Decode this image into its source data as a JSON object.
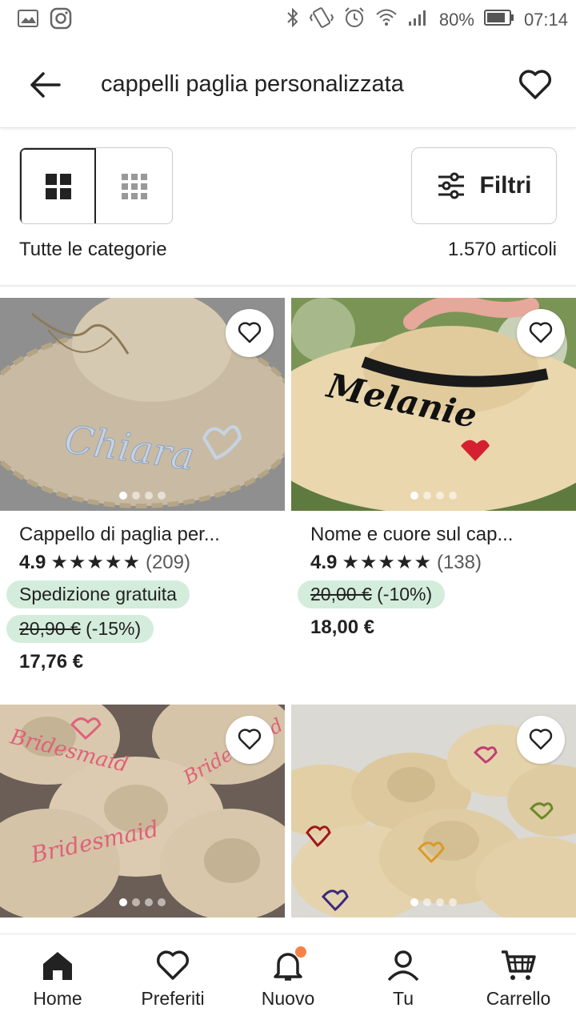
{
  "status_bar": {
    "battery": "80%",
    "time": "07:14"
  },
  "header": {
    "search_query": "cappelli paglia personalizzata"
  },
  "toolbar": {
    "filters_label": "Filtri"
  },
  "results": {
    "category": "Tutte le categorie",
    "count": "1.570 articoli"
  },
  "products": [
    {
      "title": "Cappello di paglia per...",
      "rating": "4.9",
      "stars": "★★★★★",
      "reviews": "(209)",
      "shipping": "Spedizione gratuita",
      "original_price": "20,90 €",
      "discount": "(-15%)",
      "price": "17,76 €",
      "image_text": "Chiara",
      "accent": "#c9b79a"
    },
    {
      "title": "Nome e cuore sul cap...",
      "rating": "4.9",
      "stars": "★★★★★",
      "reviews": "(138)",
      "original_price": "20,00 €",
      "discount": "(-10%)",
      "price": "18,00 €",
      "image_text": "Melanie",
      "accent": "#e8d4a8"
    },
    {
      "image_text": "Bridesmaid",
      "accent": "#d9c8ad"
    },
    {
      "accent": "#e2cfa6"
    }
  ],
  "bottom_nav": {
    "items": [
      {
        "label": "Home",
        "icon": "home-icon"
      },
      {
        "label": "Preferiti",
        "icon": "heart-icon"
      },
      {
        "label": "Nuovo",
        "icon": "bell-icon"
      },
      {
        "label": "Tu",
        "icon": "user-icon"
      },
      {
        "label": "Carrello",
        "icon": "cart-icon"
      }
    ]
  }
}
